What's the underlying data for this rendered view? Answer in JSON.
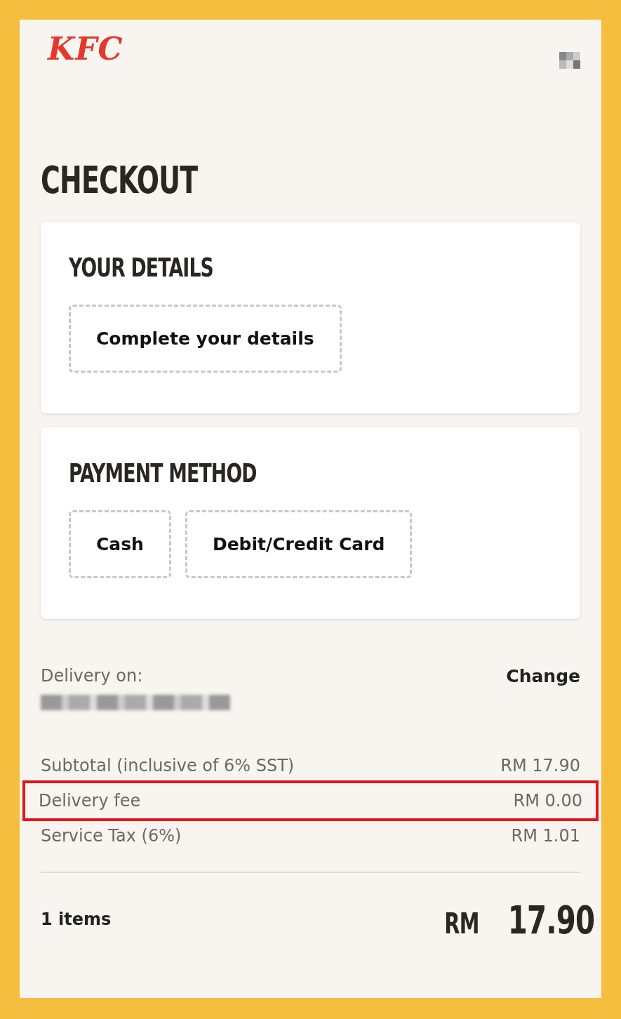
{
  "header": {
    "logo": "KFC"
  },
  "title": "CHECKOUT",
  "sections": [
    {
      "heading": "YOUR DETAILS",
      "buttons": [
        {
          "label": "Complete your details"
        }
      ]
    },
    {
      "heading": "PAYMENT METHOD",
      "buttons": [
        {
          "label": "Cash"
        },
        {
          "label": "Debit/Credit Card"
        }
      ]
    }
  ],
  "delivery": {
    "label": "Delivery on:",
    "action": "Change",
    "value_redacted": true
  },
  "summary": [
    {
      "label": "Subtotal (inclusive of 6% SST)",
      "amount": "RM 17.90",
      "highlighted": false
    },
    {
      "label": "Delivery fee",
      "amount": "RM 0.00",
      "highlighted": true
    },
    {
      "label": "Service Tax (6%)",
      "amount": "RM 1.01",
      "highlighted": false
    }
  ],
  "total": {
    "items": "1 items",
    "currency": "RM",
    "amount": "17.90"
  }
}
